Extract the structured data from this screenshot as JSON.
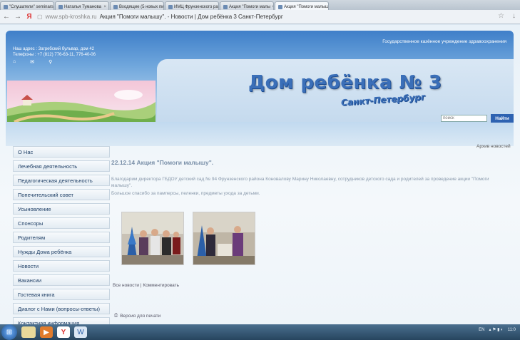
{
  "browser": {
    "tabs": [
      {
        "label": "\"Слушатели\" seminars"
      },
      {
        "label": "Наталья Туманова"
      },
      {
        "label": "Входящие (5 новых пис"
      },
      {
        "label": "ИМЦ Фрунзенского ра"
      },
      {
        "label": "Акция \"Помоги малы"
      },
      {
        "label": "Акция \"Помоги малыш",
        "active": true
      }
    ],
    "address": {
      "domain": "www.spb-kroshka.ru",
      "title": "Акция \"Помоги малышу\". - Новости | Дом ребёнка 3 Санкт-Петербург"
    }
  },
  "header": {
    "address_lines": [
      "Наш адрес : Загребский бульвар, дом 42",
      "Телефоны : +7 (812) 776-63-11, 776-40-06"
    ],
    "org": "Государственное казённое учреждение здравоохранения",
    "title": "Дом ребёнка № 3",
    "subtitle": "Санкт-Петербург",
    "search_placeholder": "поиск",
    "search_button": "Найти"
  },
  "sidebar": {
    "items": [
      {
        "label": "О Нас"
      },
      {
        "label": "Лечебная деятельность"
      },
      {
        "label": "Педагогическая деятельность"
      },
      {
        "label": "Попечительский совет"
      },
      {
        "label": "Усыновление"
      },
      {
        "label": "Спонсоры"
      },
      {
        "label": "Родителям"
      },
      {
        "label": "Нужды Дома ребёнка"
      },
      {
        "label": "Новости"
      },
      {
        "label": "Вакансии"
      },
      {
        "label": "Гостевая книга"
      },
      {
        "label": "Диалог с Нами (вопросы-ответы)"
      },
      {
        "label": "Контактная информация"
      }
    ]
  },
  "main": {
    "archive_link": "Архив новостей",
    "news_title": "22.12.14 Акция \"Помоги малышу\".",
    "news_text_1": "Благодарим директора ГБДОУ детский сад № 94 Фрунзенского района Коновалову Марину Николаевну, сотрудников детского сада и родителей за проведение акции \"Помоги малышу\".",
    "news_text_2": "Большое спасибо за памперсы, пеленки, предметы ухода за детьми.",
    "link_all_news": "Все новости",
    "link_separator": "|",
    "link_comment": "Комментировать",
    "print_version": "Версия для печати"
  },
  "taskbar": {
    "lang": "EN",
    "time": "11:0"
  }
}
